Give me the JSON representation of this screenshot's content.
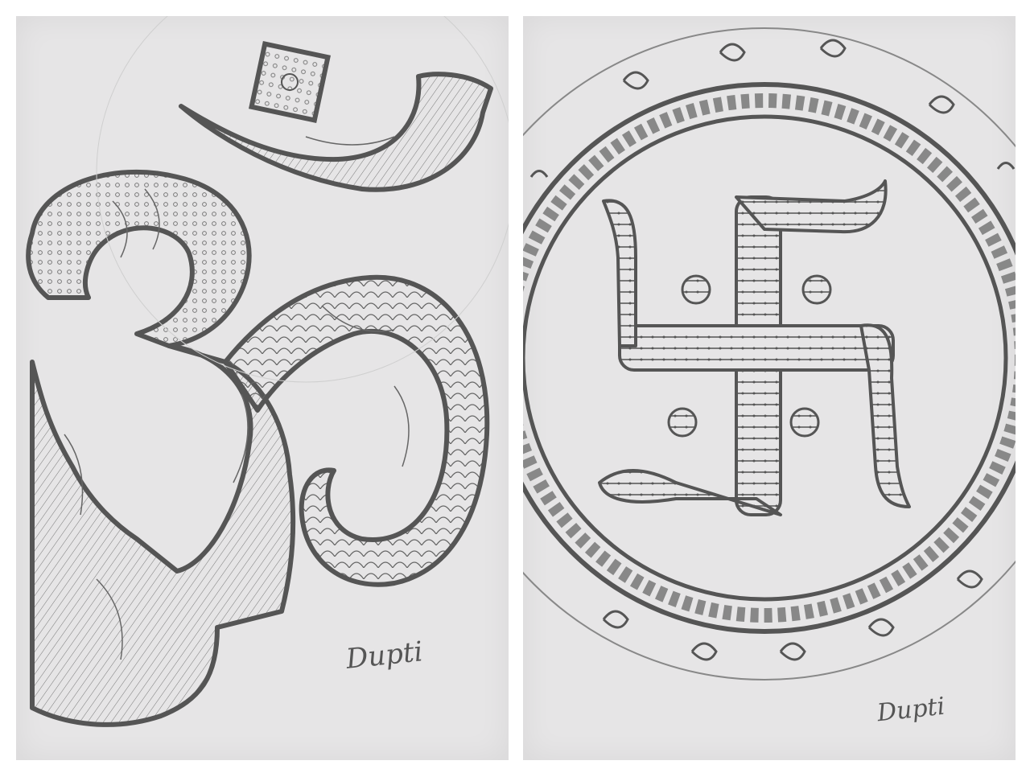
{
  "collage": {
    "panels": [
      {
        "subject": "om-symbol-sketch",
        "signature": "Dupti"
      },
      {
        "subject": "swastika-mandala-sketch",
        "signature": "Dupti"
      }
    ]
  },
  "colors": {
    "paper": "#e6e5e6",
    "pencil": "#555555",
    "shade": "#9a9a9a"
  }
}
